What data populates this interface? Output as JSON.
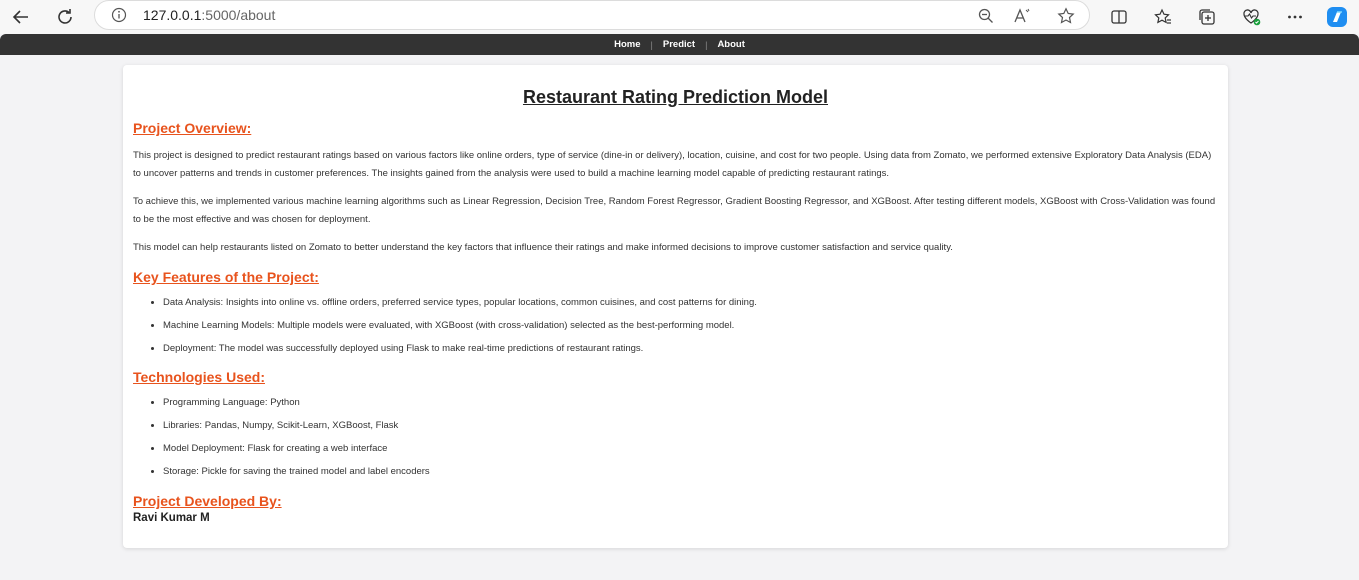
{
  "browser": {
    "url_host": "127.0.0.1",
    "url_path": ":5000/about"
  },
  "nav": {
    "items": [
      "Home",
      "Predict",
      "About"
    ]
  },
  "page": {
    "title": "Restaurant Rating Prediction Model",
    "overview": {
      "heading": "Project Overview:",
      "paragraphs": [
        "This project is designed to predict restaurant ratings based on various factors like online orders, type of service (dine-in or delivery), location, cuisine, and cost for two people. Using data from Zomato, we performed extensive Exploratory Data Analysis (EDA) to uncover patterns and trends in customer preferences. The insights gained from the analysis were used to build a machine learning model capable of predicting restaurant ratings.",
        "To achieve this, we implemented various machine learning algorithms such as Linear Regression, Decision Tree, Random Forest Regressor, Gradient Boosting Regressor, and XGBoost. After testing different models, XGBoost with Cross-Validation was found to be the most effective and was chosen for deployment.",
        "This model can help restaurants listed on Zomato to better understand the key factors that influence their ratings and make informed decisions to improve customer satisfaction and service quality."
      ]
    },
    "features": {
      "heading": "Key Features of the Project:",
      "items": [
        "Data Analysis: Insights into online vs. offline orders, preferred service types, popular locations, common cuisines, and cost patterns for dining.",
        "Machine Learning Models: Multiple models were evaluated, with XGBoost (with cross-validation) selected as the best-performing model.",
        "Deployment: The model was successfully deployed using Flask to make real-time predictions of restaurant ratings."
      ]
    },
    "technologies": {
      "heading": "Technologies Used:",
      "items": [
        "Programming Language: Python",
        "Libraries: Pandas, Numpy, Scikit-Learn, XGBoost, Flask",
        "Model Deployment: Flask for creating a web interface",
        "Storage: Pickle for saving the trained model and label encoders"
      ]
    },
    "developer": {
      "heading": "Project Developed By:",
      "name": "Ravi Kumar M"
    }
  },
  "colors": {
    "accent": "#e8531d",
    "nav_bg": "#333333",
    "page_bg": "#f3f3f5"
  }
}
